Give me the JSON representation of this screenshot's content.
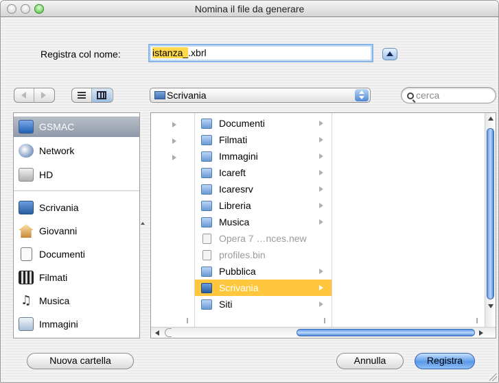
{
  "window": {
    "title": "Nomina il file da generare"
  },
  "save": {
    "label": "Registra col nome:",
    "filename_selected": "istanza_",
    "filename_rest": ".xbrl"
  },
  "toolbar": {
    "location": "Scrivania",
    "search_placeholder": "cerca"
  },
  "sidebar": {
    "devices": [
      {
        "label": "GSMAC",
        "icon": "computer-icon",
        "selected": true
      },
      {
        "label": "Network",
        "icon": "network-icon"
      },
      {
        "label": "HD",
        "icon": "hard-disk-icon"
      }
    ],
    "places": [
      {
        "label": "Scrivania",
        "icon": "desktop-folder-icon"
      },
      {
        "label": "Giovanni",
        "icon": "home-icon"
      },
      {
        "label": "Documenti",
        "icon": "document-icon"
      },
      {
        "label": "Filmati",
        "icon": "movie-icon"
      },
      {
        "label": "Musica",
        "icon": "music-icon"
      },
      {
        "label": "Immagini",
        "icon": "pictures-icon"
      }
    ]
  },
  "browser": {
    "column2": [
      {
        "label": "Documenti",
        "icon": "folder-icon",
        "has_children": true
      },
      {
        "label": "Filmati",
        "icon": "folder-icon",
        "has_children": true
      },
      {
        "label": "Immagini",
        "icon": "folder-icon",
        "has_children": true
      },
      {
        "label": "Icareft",
        "icon": "folder-icon",
        "has_children": true
      },
      {
        "label": "Icaresrv",
        "icon": "folder-icon",
        "has_children": true
      },
      {
        "label": "Libreria",
        "icon": "folder-icon",
        "has_children": true
      },
      {
        "label": "Musica",
        "icon": "folder-icon",
        "has_children": true
      },
      {
        "label": "Opera 7 …nces.new",
        "icon": "file-icon",
        "disabled": true
      },
      {
        "label": "profiles.bin",
        "icon": "file-icon",
        "disabled": true
      },
      {
        "label": "Pubblica",
        "icon": "folder-icon",
        "has_children": true
      },
      {
        "label": "Scrivania",
        "icon": "desktop-folder-icon",
        "has_children": true,
        "selected": true
      },
      {
        "label": "Siti",
        "icon": "folder-icon",
        "has_children": true
      }
    ]
  },
  "buttons": {
    "new_folder": "Nuova cartella",
    "cancel": "Annulla",
    "save": "Registra"
  },
  "colors": {
    "selection": "#fec73d",
    "default_button": "#5a9ae8",
    "text_highlight": "#ffd84a"
  }
}
